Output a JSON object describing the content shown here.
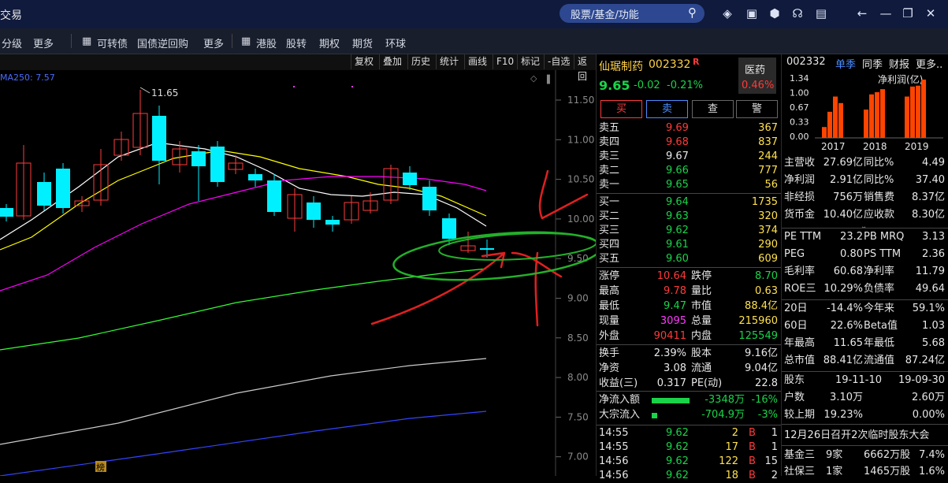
{
  "window": {
    "title": "交易",
    "search_placeholder": "股票/基金/功能"
  },
  "menu": [
    {
      "label": "分级"
    },
    {
      "label": "更多"
    },
    {
      "label": "可转债",
      "icon": "grid-icon"
    },
    {
      "label": "国债逆回购"
    },
    {
      "label": "更多"
    },
    {
      "label": "港股",
      "icon": "grid-icon"
    },
    {
      "label": "股转"
    },
    {
      "label": "期权"
    },
    {
      "label": "期货"
    },
    {
      "label": "环球"
    }
  ],
  "chart_toolbar": [
    "复权",
    "叠加",
    "历史",
    "统计",
    "画线",
    "F10",
    "标记",
    "-自选",
    "返回"
  ],
  "chart": {
    "ma_label": "MA250: 7.57",
    "high_label": "11.65",
    "y_ticks": [
      "11.50",
      "11.00",
      "10.50",
      "10.00",
      "9.50",
      "9.00",
      "8.50",
      "8.00",
      "7.50",
      "7.00"
    ],
    "bottom_badge": "榜",
    "colors": {
      "up": "#ff3b3b",
      "down": "#00f0ff",
      "ma5": "#ffffff",
      "ma10": "#ffff00",
      "ma20": "#ff00ff",
      "ma60": "#33ff33",
      "ma120": "#cccccc",
      "ma250": "#3344ff"
    }
  },
  "quote": {
    "name": "仙琚制药",
    "code": "002332",
    "flag": "R",
    "sector": "医药",
    "sector_pct": "0.46%",
    "price": "9.65",
    "change": "-0.02",
    "change_pct": "-0.21%",
    "buttons": [
      "买",
      "卖",
      "查",
      "警"
    ],
    "asks": [
      {
        "label": "卖五",
        "price": "9.69",
        "vol": "367"
      },
      {
        "label": "卖四",
        "price": "9.68",
        "vol": "837"
      },
      {
        "label": "卖三",
        "price": "9.67",
        "vol": "244"
      },
      {
        "label": "卖二",
        "price": "9.66",
        "vol": "777"
      },
      {
        "label": "卖一",
        "price": "9.65",
        "vol": "56"
      }
    ],
    "bids": [
      {
        "label": "买一",
        "price": "9.64",
        "vol": "1735"
      },
      {
        "label": "买二",
        "price": "9.63",
        "vol": "320"
      },
      {
        "label": "买三",
        "price": "9.62",
        "vol": "374"
      },
      {
        "label": "买四",
        "price": "9.61",
        "vol": "290"
      },
      {
        "label": "买五",
        "price": "9.60",
        "vol": "609"
      }
    ],
    "stats": [
      [
        "涨停",
        "10.64",
        "跌停",
        "8.70"
      ],
      [
        "最高",
        "9.78",
        "量比",
        "0.63"
      ],
      [
        "最低",
        "9.47",
        "市值",
        "88.4亿"
      ],
      [
        "现量",
        "3095",
        "总量",
        "215960"
      ],
      [
        "外盘",
        "90411",
        "内盘",
        "125549"
      ]
    ],
    "stats2": [
      [
        "换手",
        "2.39%",
        "股本",
        "9.16亿"
      ],
      [
        "净资",
        "3.08",
        "流通",
        "9.04亿"
      ],
      [
        "收益(三)",
        "0.317",
        "PE(动)",
        "22.8"
      ]
    ],
    "flow": [
      {
        "label": "净流入额",
        "value": "-3348万",
        "pct": "-16%",
        "bar": 0.85
      },
      {
        "label": "大宗流入",
        "value": "-704.9万",
        "pct": "-3%",
        "bar": 0.12
      }
    ],
    "ticks": [
      {
        "time": "14:55",
        "price": "9.62",
        "vol": "2",
        "side": "B",
        "n": "1"
      },
      {
        "time": "14:55",
        "price": "9.62",
        "vol": "17",
        "side": "B",
        "n": "1"
      },
      {
        "time": "14:56",
        "price": "9.62",
        "vol": "122",
        "side": "B",
        "n": "15"
      },
      {
        "time": "14:56",
        "price": "9.62",
        "vol": "18",
        "side": "B",
        "n": "2"
      }
    ]
  },
  "fundamentals": {
    "code": "002332",
    "tabs": [
      "单季",
      "同季",
      "财报",
      "更多.."
    ],
    "bar_chart_title": "净利润(亿)",
    "y_ticks": [
      "1.34",
      "1.00",
      "0.67",
      "0.33",
      "0.00"
    ],
    "years": [
      "2017",
      "2018",
      "2019"
    ],
    "metrics": [
      [
        "主营收",
        "27.69亿",
        "同比%",
        "4.49"
      ],
      [
        "净利润",
        "2.91亿",
        "同比%",
        "37.40"
      ],
      [
        "非经损",
        "756万",
        "销售费",
        "8.37亿"
      ],
      [
        "货币金",
        "10.40亿",
        "应收款",
        "8.30亿"
      ]
    ],
    "ratios": [
      [
        "PE TTM",
        "23.2",
        "PB MRQ",
        "3.13"
      ],
      [
        "PEG",
        "0.80",
        "PS TTM",
        "2.36"
      ],
      [
        "毛利率",
        "60.68",
        "净利率",
        "11.79"
      ],
      [
        "ROE三",
        "10.29%",
        "负债率",
        "49.64"
      ]
    ],
    "perf": [
      [
        "20日",
        "-14.4%",
        "今年来",
        "59.1%"
      ],
      [
        "60日",
        "22.6%",
        "Beta值",
        "1.03"
      ],
      [
        "年最高",
        "11.65",
        "年最低",
        "5.68"
      ],
      [
        "总市值",
        "88.41亿",
        "流通值",
        "87.24亿"
      ]
    ],
    "holders_header": [
      "股东",
      "19-11-10",
      "19-09-30"
    ],
    "holders": [
      [
        "户数",
        "3.10万",
        "2.60万"
      ],
      [
        "较上期",
        "19.23%",
        "0.00%"
      ]
    ],
    "notice": "12月26日召开2次临时股东大会",
    "funds": [
      [
        "基金三",
        "9家",
        "6662万股",
        "7.4%"
      ],
      [
        "社保三",
        "1家",
        "1465万股",
        "1.6%"
      ]
    ]
  }
}
